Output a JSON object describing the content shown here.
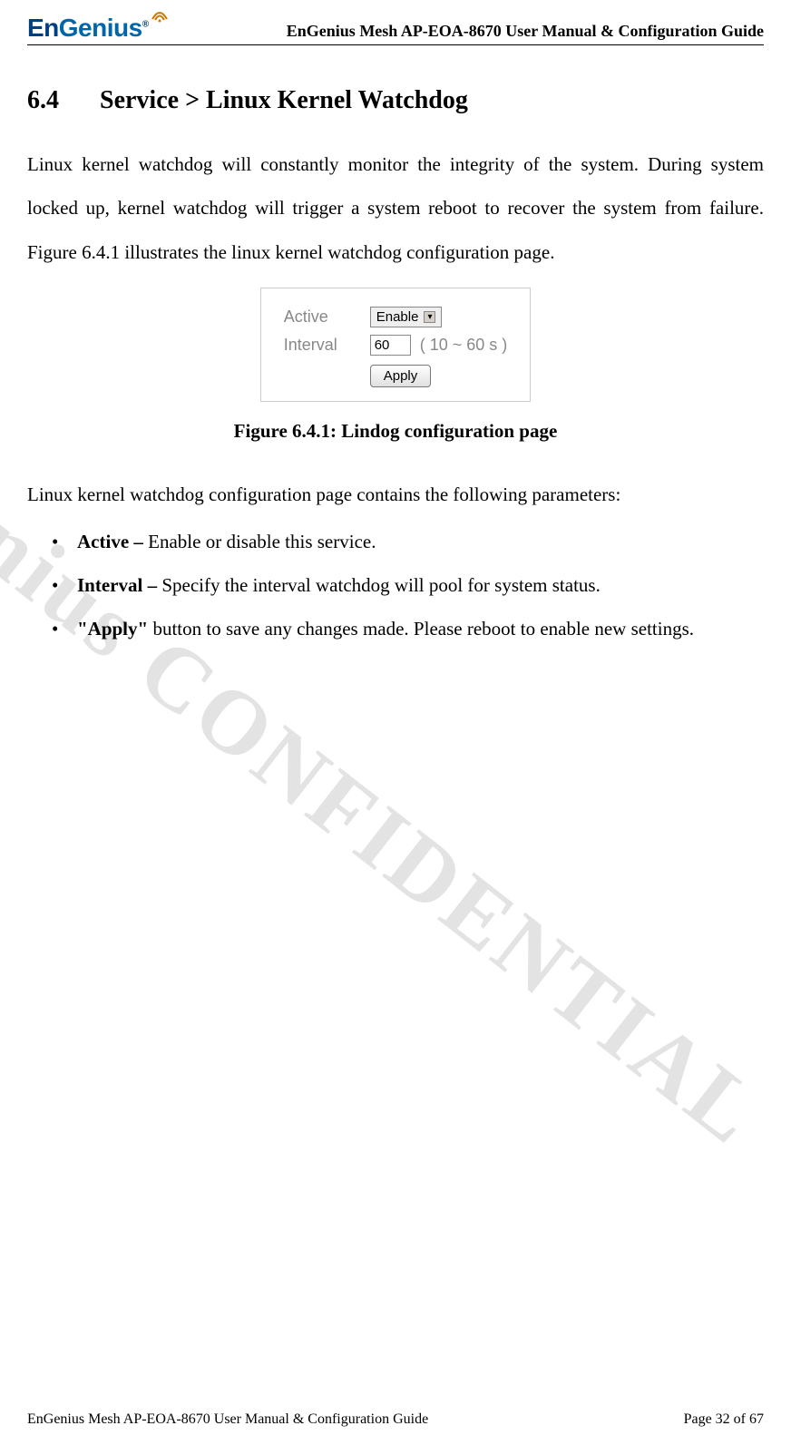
{
  "header": {
    "logo_text_1": "En",
    "logo_text_2": "Genius",
    "logo_reg": "®",
    "doc_title": "EnGenius Mesh AP-EOA-8670 User Manual & Configuration Guide"
  },
  "section": {
    "number": "6.4",
    "title": "Service > Linux Kernel Watchdog"
  },
  "intro_text": "Linux kernel watchdog will constantly monitor the integrity of the system. During system locked up, kernel watchdog will trigger a system reboot to recover the system from failure. Figure 6.4.1 illustrates the linux kernel watchdog configuration page.",
  "config": {
    "active_label": "Active",
    "active_value": "Enable",
    "interval_label": "Interval",
    "interval_value": "60",
    "interval_range": "( 10 ~ 60 s )",
    "apply_label": "Apply"
  },
  "figure_caption": "Figure 6.4.1: Lindog configuration page",
  "param_intro": "Linux kernel watchdog configuration page contains the following parameters:",
  "params": [
    {
      "name": "Active – ",
      "desc": "Enable or disable this service."
    },
    {
      "name": "Interval – ",
      "desc": "Specify the interval watchdog will pool for system status."
    },
    {
      "name": "\"Apply\"",
      "desc": " button to save any changes made. Please reboot to enable new settings."
    }
  ],
  "watermark": "EnGenius CONFIDENTIAL",
  "footer": {
    "left": "EnGenius Mesh AP-EOA-8670 User Manual & Configuration Guide",
    "right": "Page 32 of 67"
  }
}
